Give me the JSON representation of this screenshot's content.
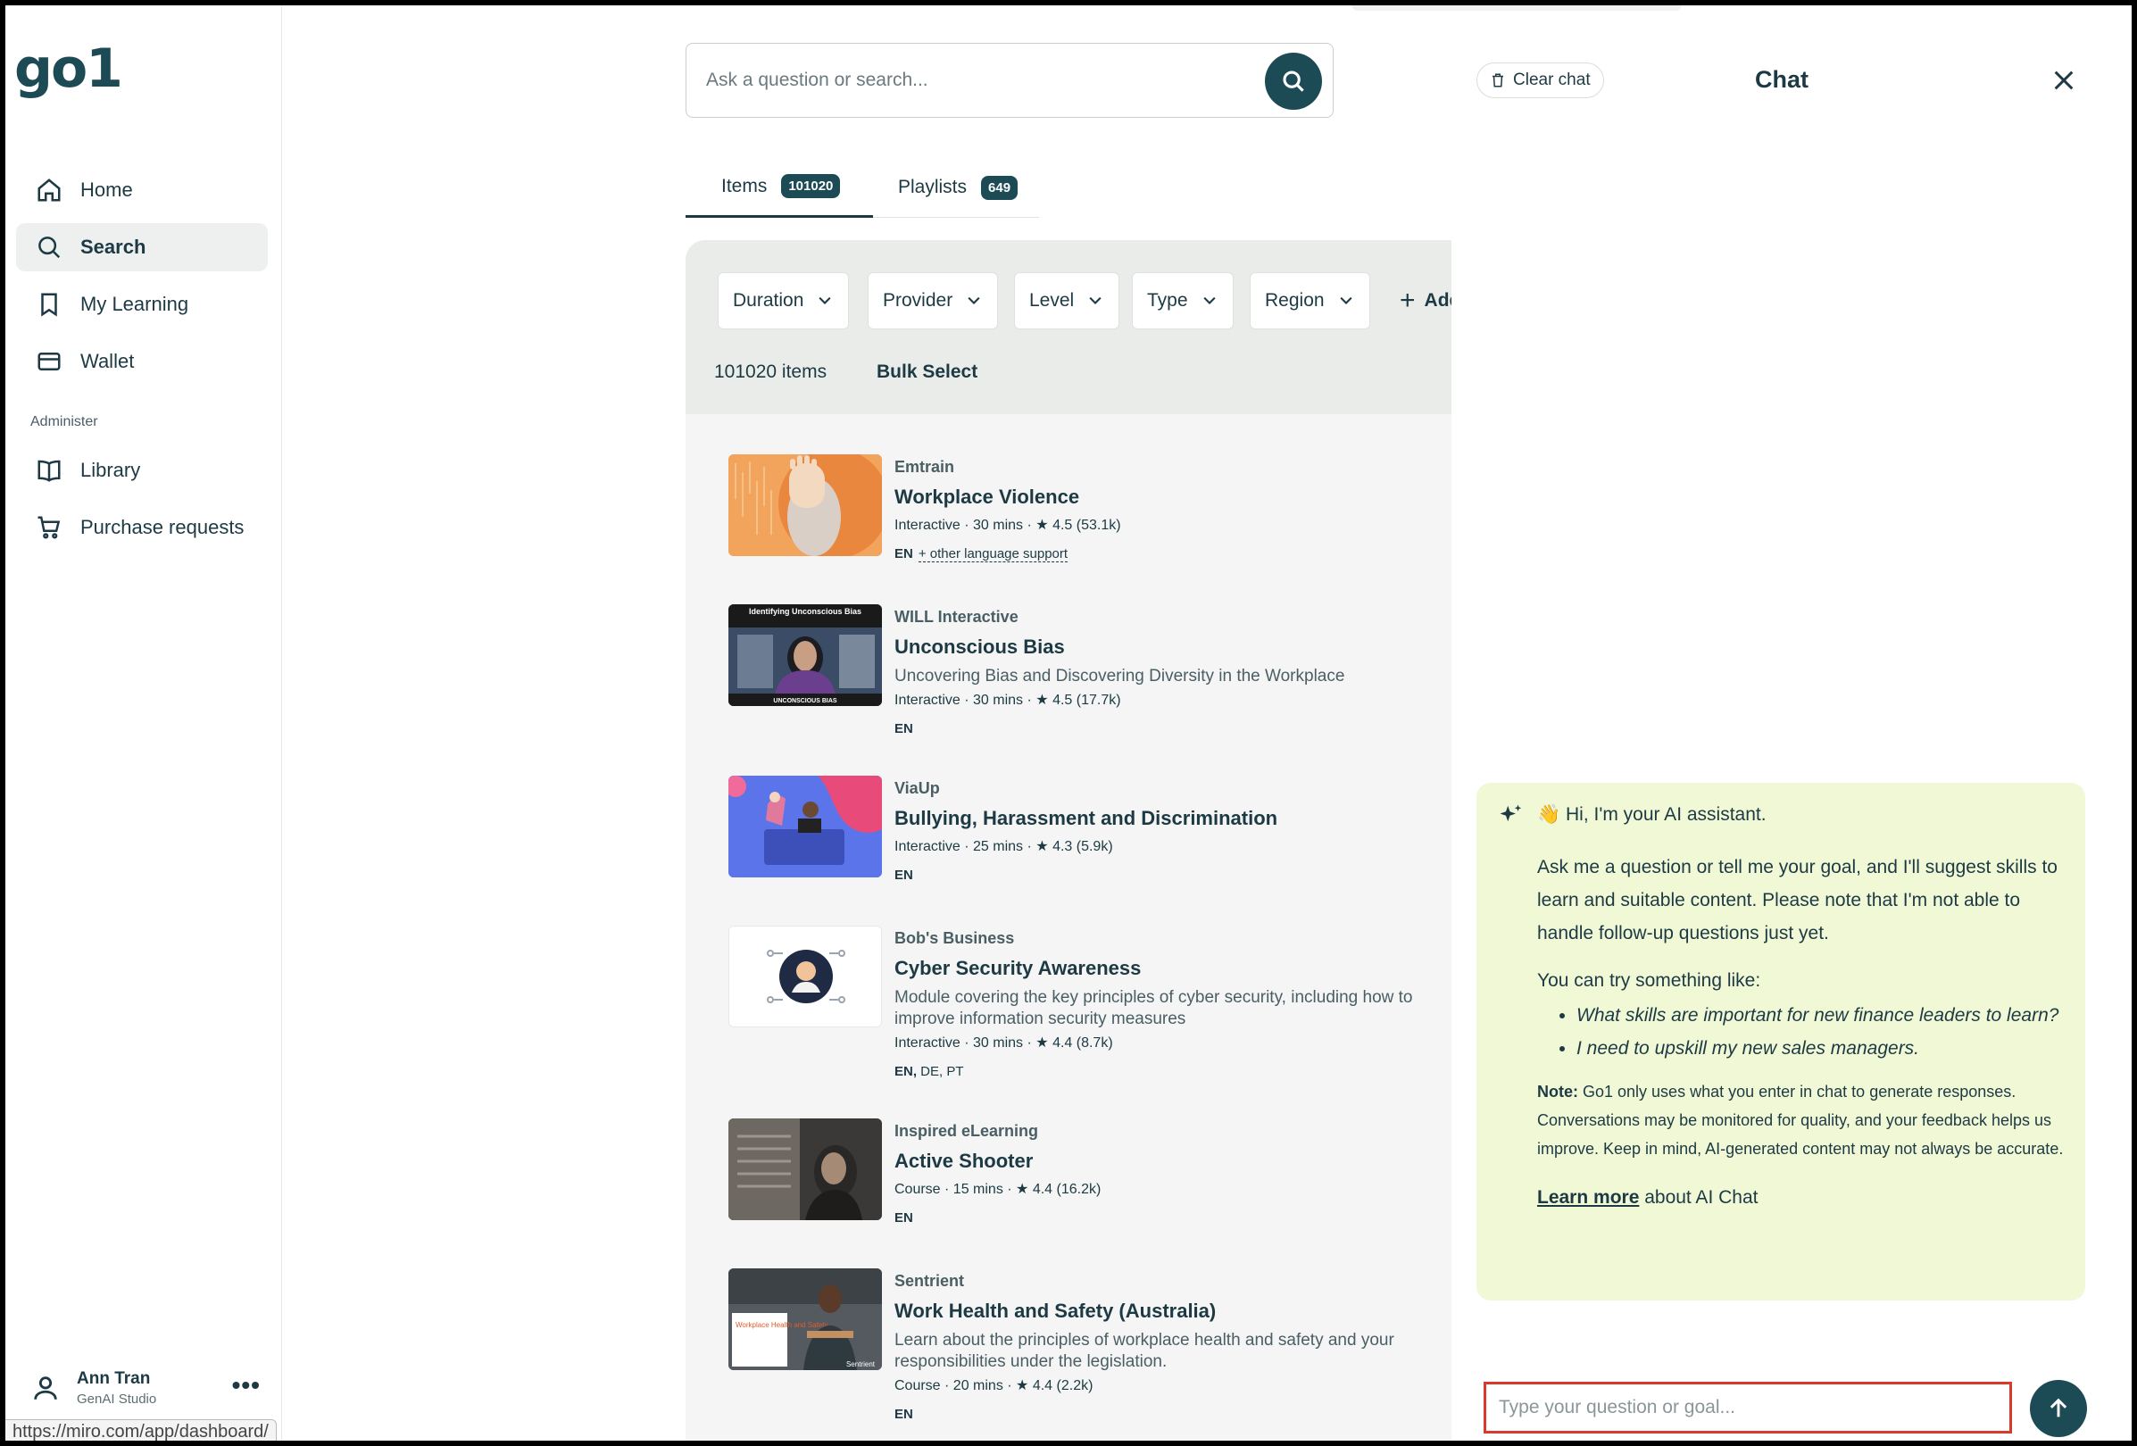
{
  "logo": "go1",
  "sidebar": {
    "items": [
      {
        "label": "Home",
        "icon": "home-icon"
      },
      {
        "label": "Search",
        "icon": "search-icon",
        "active": true
      },
      {
        "label": "My Learning",
        "icon": "bookmark-icon"
      },
      {
        "label": "Wallet",
        "icon": "wallet-icon"
      }
    ],
    "section_label": "Administer",
    "admin_items": [
      {
        "label": "Library",
        "icon": "book-icon"
      },
      {
        "label": "Purchase requests",
        "icon": "cart-icon"
      }
    ],
    "user": {
      "name": "Ann Tran",
      "org": "GenAI Studio",
      "more": "•••"
    },
    "status_url": "https://miro.com/app/dashboard/"
  },
  "search": {
    "placeholder": "Ask a question or search..."
  },
  "tabs": [
    {
      "label": "Items",
      "count": "101020",
      "active": true
    },
    {
      "label": "Playlists",
      "count": "649"
    }
  ],
  "filters": {
    "options": [
      "Duration",
      "Provider",
      "Level",
      "Type",
      "Region"
    ],
    "add_label": "Add filter",
    "result_count": "101020 items",
    "bulk_select": "Bulk Select"
  },
  "results": [
    {
      "provider": "Emtrain",
      "title": "Workplace Violence",
      "description": "",
      "meta": "Interactive · 30 mins · ★ 4.5 (53.1k)",
      "lang_bold": "EN",
      "lang_rest": "",
      "lang_more": "+ other language support"
    },
    {
      "provider": "WILL Interactive",
      "title": "Unconscious Bias",
      "description": "Uncovering Bias and Discovering Diversity in the Workplace",
      "meta": "Interactive · 30 mins · ★ 4.5 (17.7k)",
      "lang_bold": "EN",
      "lang_rest": "",
      "lang_more": "",
      "thumb_top": "Identifying Unconscious Bias",
      "thumb_bottom": "UNCONSCIOUS BIAS"
    },
    {
      "provider": "ViaUp",
      "title": "Bullying, Harassment and Discrimination",
      "description": "",
      "meta": "Interactive · 25 mins · ★ 4.3 (5.9k)",
      "lang_bold": "EN",
      "lang_rest": "",
      "lang_more": ""
    },
    {
      "provider": "Bob's Business",
      "title": "Cyber Security Awareness",
      "description": "Module covering the key principles of cyber security, including how to improve information security measures",
      "meta": "Interactive · 30 mins · ★ 4.4 (8.7k)",
      "lang_bold": "EN,",
      "lang_rest": " DE, PT",
      "lang_more": ""
    },
    {
      "provider": "Inspired eLearning",
      "title": "Active Shooter",
      "description": "",
      "meta": "Course · 15 mins · ★ 4.4 (16.2k)",
      "lang_bold": "EN",
      "lang_rest": "",
      "lang_more": ""
    },
    {
      "provider": "Sentrient",
      "title": "Work Health and Safety (Australia)",
      "description": "Learn about the principles of workplace health and safety and your responsibilities under the legislation.",
      "meta": "Course · 20 mins · ★ 4.4 (2.2k)",
      "lang_bold": "EN",
      "lang_rest": "",
      "lang_more": "",
      "thumb_caption": "Workplace Health and Safety",
      "thumb_brand": "Sentrient"
    }
  ],
  "chat": {
    "clear_label": "Clear chat",
    "title": "Chat",
    "greeting": "👋 Hi, I'm your AI assistant.",
    "intro": "Ask me a question or tell me your goal, and I'll suggest skills to learn and suitable content. Please note that I'm not able to handle follow-up questions just yet.",
    "try_label": "You can try something like:",
    "examples": [
      "What skills are important for new finance leaders to learn?",
      "I need to upskill my new sales managers."
    ],
    "note_label": "Note:",
    "note_text": " Go1 only uses what you enter in chat to generate responses. Conversations may be monitored for quality, and your feedback helps us improve. Keep in mind, AI-generated content may not always be accurate.",
    "learn_link": "Learn more",
    "learn_rest": " about AI Chat",
    "input_placeholder": "Type your question or goal..."
  },
  "colors": {
    "brand": "#1d4b55",
    "ai_card": "#f0f8d6",
    "focus_outline": "#d93a2b"
  }
}
